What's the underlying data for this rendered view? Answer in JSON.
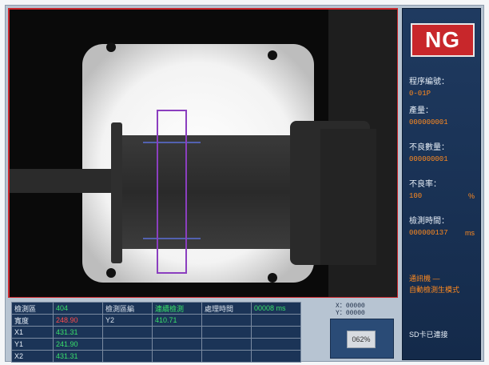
{
  "status": {
    "result": "NG"
  },
  "stats": {
    "model_label": "程序編號：",
    "model_value": "0-01P",
    "output_label": "產量：",
    "output_value": "000000001",
    "defect_count_label": "不良數量：",
    "defect_count_value": "000000001",
    "defect_rate_label": "不良率：",
    "defect_rate_value": "100",
    "defect_rate_unit": "%",
    "inspect_time_label": "檢測時間：",
    "inspect_time_value": "000000137",
    "inspect_time_unit": "ms"
  },
  "messages": {
    "mode_line1": "通訊機 —",
    "mode_line2": "自動檢測生模式",
    "sd": "SD卡已連接"
  },
  "table": {
    "rows": [
      [
        "檢測區",
        "404",
        "檢測區編",
        "連續檢測",
        "處理時間",
        "00008 ms"
      ],
      [
        "寬度",
        "248.90",
        "Y2",
        "410.71",
        "",
        ""
      ],
      [
        "X1",
        "431.31",
        "",
        "",
        "",
        ""
      ],
      [
        "Y1",
        "241.90",
        "",
        "",
        "",
        ""
      ],
      [
        "X2",
        "431.31",
        "",
        "",
        "",
        ""
      ]
    ]
  },
  "coords": {
    "x_label": "X：",
    "x_value": "00000",
    "y_label": "Y：",
    "y_value": "00000"
  },
  "zoom": {
    "label": "062%"
  },
  "colors": {
    "ng_red": "#c8272b",
    "panel_blue": "#1f3a60",
    "accent_orange": "#ff8a1f",
    "roi_purple": "#8b3fbf",
    "ok_green": "#39e06a"
  }
}
